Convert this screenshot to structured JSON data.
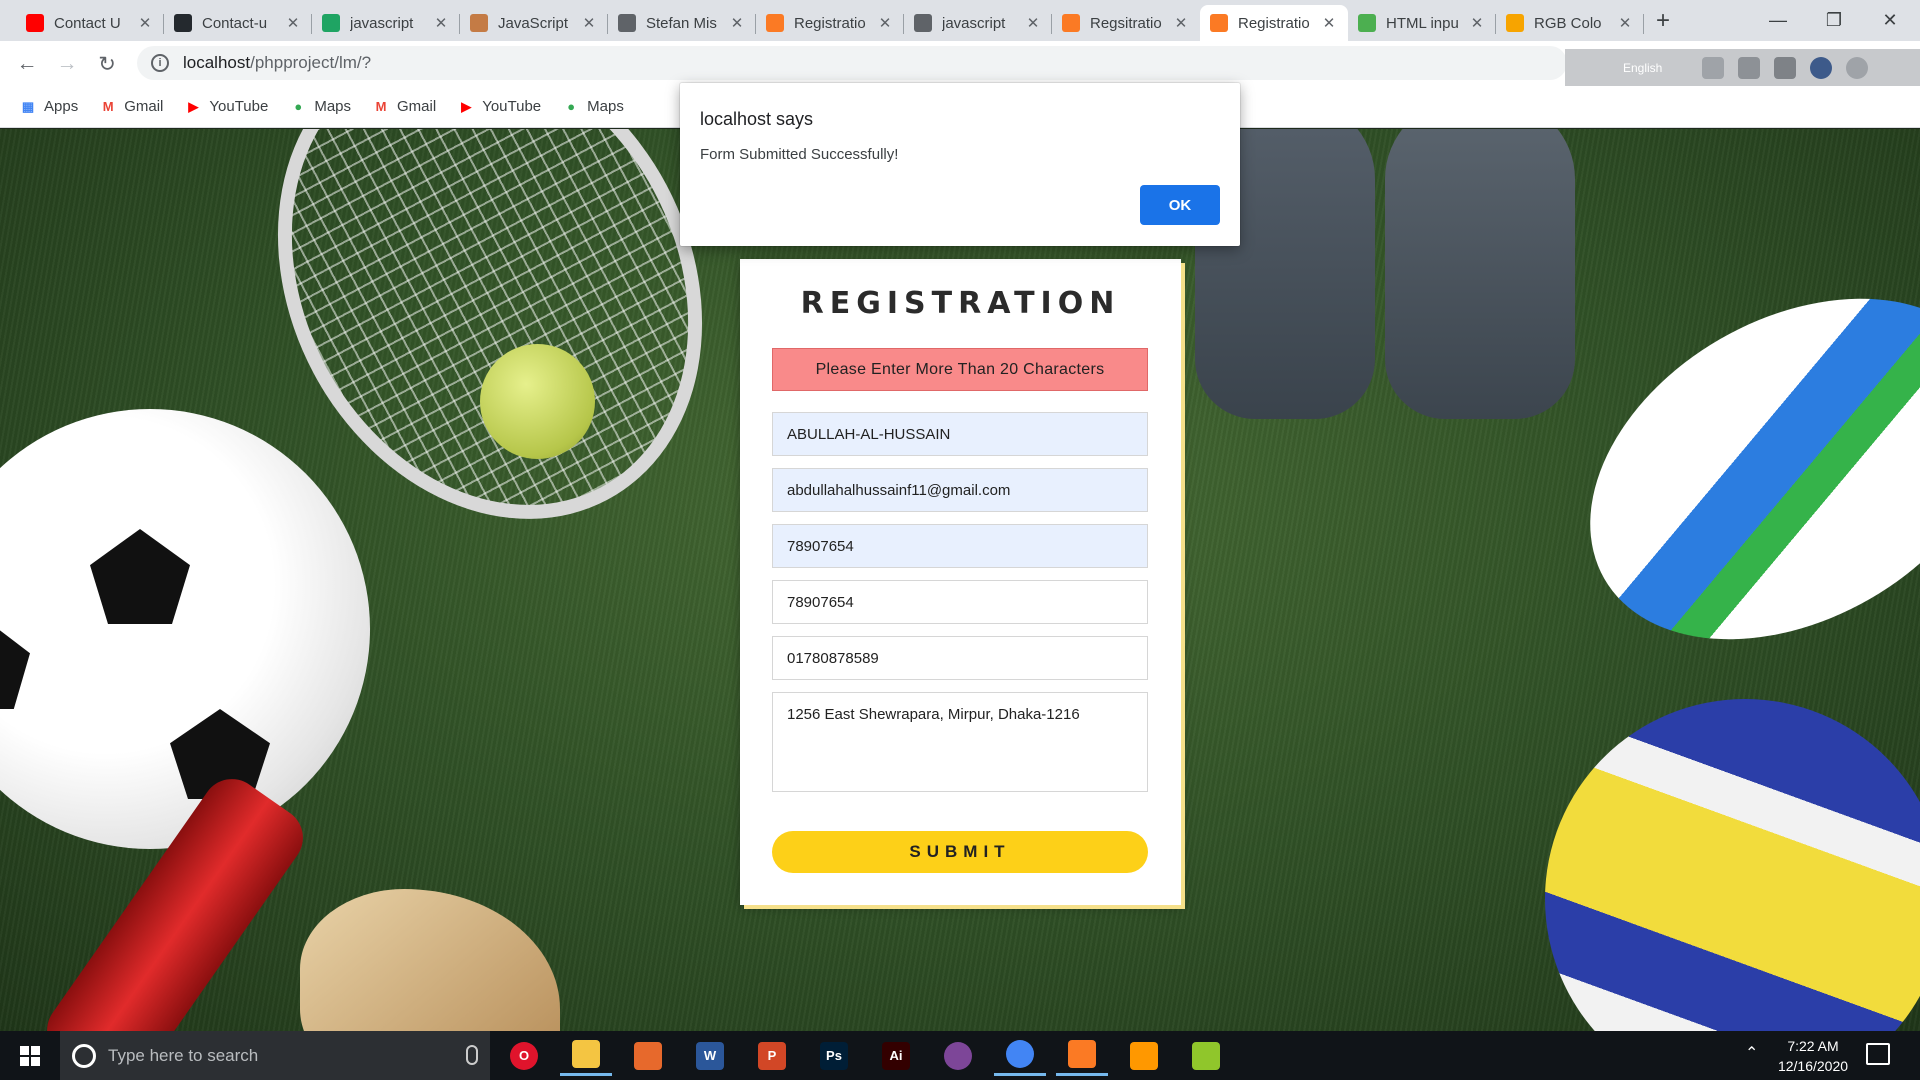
{
  "browser": {
    "tabs": [
      {
        "title": "Contact U",
        "icon": "youtube-icon",
        "color": "#ff0000"
      },
      {
        "title": "Contact-u",
        "icon": "github-icon",
        "color": "#24292e"
      },
      {
        "title": "javascript",
        "icon": "google-drive-icon",
        "color": "#1fa463"
      },
      {
        "title": "JavaScript",
        "icon": "avatar-icon",
        "color": "#c47b45"
      },
      {
        "title": "Stefan Mis",
        "icon": "globe-icon",
        "color": "#5f6368"
      },
      {
        "title": "Registratio",
        "icon": "xampp-icon",
        "color": "#fb7a24"
      },
      {
        "title": "javascript",
        "icon": "globe-icon",
        "color": "#5f6368"
      },
      {
        "title": "Regsitratio",
        "icon": "xampp-icon",
        "color": "#fb7a24"
      },
      {
        "title": "Registratio",
        "icon": "xampp-icon",
        "color": "#fb7a24"
      },
      {
        "title": "HTML inpu",
        "icon": "w3schools-icon",
        "color": "#4caf50"
      },
      {
        "title": "RGB Colo",
        "icon": "rapidtables-icon",
        "color": "#f7a400"
      }
    ],
    "active_tab_index": 8,
    "url_host": "localhost",
    "url_path": "/phpproject/lm/?",
    "extension_language": "English"
  },
  "bookmarks": [
    {
      "label": "Apps",
      "icon": "apps-grid-icon",
      "color": "#4285f4"
    },
    {
      "label": "Gmail",
      "icon": "gmail-icon",
      "color": "#ea4335"
    },
    {
      "label": "YouTube",
      "icon": "youtube-icon",
      "color": "#ff0000"
    },
    {
      "label": "Maps",
      "icon": "maps-pin-icon",
      "color": "#34a853"
    },
    {
      "label": "Gmail",
      "icon": "gmail-icon",
      "color": "#ea4335"
    },
    {
      "label": "YouTube",
      "icon": "youtube-icon",
      "color": "#ff0000"
    },
    {
      "label": "Maps",
      "icon": "maps-pin-icon",
      "color": "#34a853"
    }
  ],
  "dialog": {
    "title": "localhost says",
    "message": "Form Submitted Successfully!",
    "ok_label": "OK"
  },
  "form": {
    "heading": "REGISTRATION",
    "error": "Please Enter More Than 20 Characters",
    "name": "ABULLAH-AL-HUSSAIN",
    "email": "abdullahalhussainf11@gmail.com",
    "password": "78907654",
    "confirm_password": "78907654",
    "phone": "01780878589",
    "address": "1256 East Shewrapara, Mirpur, Dhaka-1216",
    "submit_label": "SUBMIT"
  },
  "taskbar": {
    "search_placeholder": "Type here to search",
    "apps": [
      {
        "name": "opera",
        "glyph": "O",
        "color": "#e0142c"
      },
      {
        "name": "file-explorer",
        "glyph": "",
        "color": "#f4c542"
      },
      {
        "name": "matlab",
        "glyph": "",
        "color": "#e7692c"
      },
      {
        "name": "word",
        "glyph": "W",
        "color": "#2b579a"
      },
      {
        "name": "powerpoint",
        "glyph": "P",
        "color": "#d24726"
      },
      {
        "name": "photoshop",
        "glyph": "Ps",
        "color": "#001e36"
      },
      {
        "name": "illustrator",
        "glyph": "Ai",
        "color": "#330000"
      },
      {
        "name": "tor-browser",
        "glyph": "",
        "color": "#7d4698"
      },
      {
        "name": "chrome",
        "glyph": "",
        "color": "#4285f4"
      },
      {
        "name": "xampp",
        "glyph": "",
        "color": "#fb7a24"
      },
      {
        "name": "sublime-text",
        "glyph": "",
        "color": "#ff9800"
      },
      {
        "name": "notepad-plus-plus",
        "glyph": "",
        "color": "#90c62b"
      }
    ],
    "time": "7:22 AM",
    "date": "12/16/2020"
  },
  "colors": {
    "submit": "#fdd018",
    "error_bg": "#f98a8a",
    "ok_button": "#1a73e8",
    "autofill": "#e8f0fe"
  }
}
